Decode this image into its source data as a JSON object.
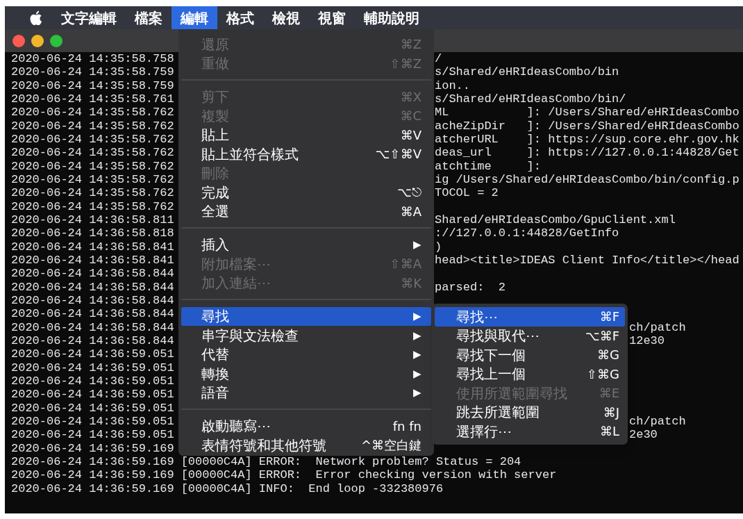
{
  "menu_bar": {
    "items": [
      {
        "label": "文字編輯",
        "selected": false
      },
      {
        "label": "檔案",
        "selected": false
      },
      {
        "label": "編輯",
        "selected": true
      },
      {
        "label": "格式",
        "selected": false
      },
      {
        "label": "檢視",
        "selected": false
      },
      {
        "label": "視窗",
        "selected": false
      },
      {
        "label": "輔助說明",
        "selected": false
      }
    ]
  },
  "terminal": {
    "lines": [
      {
        "timestamp": "2020-06-24 14:35:58.758",
        "message": "/",
        "kind": "menu_edge"
      },
      {
        "timestamp": "2020-06-24 14:35:58.759",
        "message": "s/Shared/eHRIdeasCombo/bin",
        "kind": "menu_edge"
      },
      {
        "timestamp": "2020-06-24 14:35:58.759",
        "message": "ion..",
        "kind": "menu_edge"
      },
      {
        "timestamp": "2020-06-24 14:35:58.761",
        "message": "s/Shared/eHRIdeasCombo/bin/",
        "kind": "menu_edge"
      },
      {
        "timestamp": "2020-06-24 14:35:58.762",
        "message": "ML           ]: /Users/Shared/eHRIdeasCombo",
        "kind": "menu_edge"
      },
      {
        "timestamp": "2020-06-24 14:35:58.762",
        "message": "acheZipDir   ]: /Users/Shared/eHRIdeasCombo",
        "kind": "menu_edge"
      },
      {
        "timestamp": "2020-06-24 14:35:58.762",
        "message": "atcherURL    ]: https://sup.core.ehr.gov.hk",
        "kind": "menu_edge"
      },
      {
        "timestamp": "2020-06-24 14:35:58.762",
        "message": "deas_url     ]: https://127.0.0.1:44828/Get",
        "kind": "menu_edge"
      },
      {
        "timestamp": "2020-06-24 14:35:58.762",
        "message": "atchtime     ]:",
        "kind": "menu_edge"
      },
      {
        "timestamp": "2020-06-24 14:35:58.762",
        "message": "ig /Users/Shared/eHRIdeasCombo/bin/config.p",
        "kind": "menu_edge"
      },
      {
        "timestamp": "2020-06-24 14:35:58.762",
        "message": "TOCOL = 2",
        "kind": "menu_edge"
      },
      {
        "timestamp": "2020-06-24 14:35:58.762"
      },
      {
        "timestamp": "2020-06-24 14:36:58.811",
        "message": "Shared/eHRIdeasCombo/GpuClient.xml",
        "kind": "menu_edge"
      },
      {
        "timestamp": "2020-06-24 14:36:58.818",
        "message": "://127.0.0.1:44828/GetInfo",
        "kind": "menu_edge"
      },
      {
        "timestamp": "2020-06-24 14:36:58.841",
        "message": ")",
        "kind": "menu_edge"
      },
      {
        "timestamp": "2020-06-24 14:36:58.841",
        "message": "head><title>IDEAS Client Info</title></head",
        "kind": "menu_edge"
      },
      {
        "timestamp": "2020-06-24 14:36:58.844"
      },
      {
        "timestamp": "2020-06-24 14:36:58.844",
        "message": "parsed:  2",
        "kind": "menu_edge"
      },
      {
        "timestamp": "2020-06-24 14:36:58.844"
      },
      {
        "timestamp": "2020-06-24 14:36:58.844"
      },
      {
        "timestamp": "2020-06-24 14:36:58.844",
        "message": "ch/patch",
        "kind": "submenu_edge"
      },
      {
        "timestamp": "2020-06-24 14:36:58.844",
        "message": "12e30",
        "kind": "submenu_edge"
      },
      {
        "timestamp": "2020-06-24 14:36:59.051"
      },
      {
        "timestamp": "2020-06-24 14:36:59.051"
      },
      {
        "timestamp": "2020-06-24 14:36:59.051"
      },
      {
        "timestamp": "2020-06-24 14:36:59.051"
      },
      {
        "timestamp": "2020-06-24 14:36:59.051"
      },
      {
        "timestamp": "2020-06-24 14:36:59.051",
        "message": "ch/patch",
        "kind": "submenu_edge"
      },
      {
        "timestamp": "2020-06-24 14:36:59.051",
        "message": "2e30",
        "kind": "submenu_edge"
      },
      {
        "timestamp": "2020-06-24 14:36:59.169"
      },
      {
        "timestamp": "2020-06-24 14:36:59.169",
        "message": "[00000C4A] ERROR:  Network problem? Status = 204",
        "kind": "inline"
      },
      {
        "timestamp": "2020-06-24 14:36:59.169",
        "message": "[00000C4A] ERROR:  Error checking version with server",
        "kind": "inline"
      },
      {
        "timestamp": "2020-06-24 14:36:59.169",
        "message": "[00000C4A] INFO:  End loop -332380976",
        "kind": "inline"
      }
    ]
  },
  "edit_menu": {
    "items": [
      {
        "kind": "item",
        "label": "還原",
        "shortcut": "⌘Z",
        "disabled": true,
        "selected": false
      },
      {
        "kind": "item",
        "label": "重做",
        "shortcut": "⇧⌘Z",
        "disabled": true,
        "selected": false
      },
      {
        "kind": "separator"
      },
      {
        "kind": "item",
        "label": "剪下",
        "shortcut": "⌘X",
        "disabled": true,
        "selected": false
      },
      {
        "kind": "item",
        "label": "複製",
        "shortcut": "⌘C",
        "disabled": true,
        "selected": false
      },
      {
        "kind": "item",
        "label": "貼上",
        "shortcut": "⌘V",
        "disabled": false,
        "selected": false
      },
      {
        "kind": "item",
        "label": "貼上並符合樣式",
        "shortcut": "⌥⇧⌘V",
        "disabled": false,
        "selected": false
      },
      {
        "kind": "item",
        "label": "刪除",
        "disabled": true,
        "selected": false
      },
      {
        "kind": "item",
        "label": "完成",
        "shortcut": "⌥⎋",
        "disabled": false,
        "selected": false
      },
      {
        "kind": "item",
        "label": "全選",
        "shortcut": "⌘A",
        "disabled": false,
        "selected": false
      },
      {
        "kind": "separator"
      },
      {
        "kind": "item",
        "label": "插入",
        "arrow": "▶",
        "disabled": false,
        "selected": false
      },
      {
        "kind": "item",
        "label": "附加檔案⋯",
        "shortcut": "⇧⌘A",
        "disabled": true,
        "selected": false
      },
      {
        "kind": "item",
        "label": "加入連結⋯",
        "shortcut": "⌘K",
        "disabled": true,
        "selected": false
      },
      {
        "kind": "separator"
      },
      {
        "kind": "item",
        "label": "尋找",
        "arrow": "▶",
        "disabled": false,
        "selected": true
      },
      {
        "kind": "item",
        "label": "串字與文法檢查",
        "arrow": "▶",
        "disabled": false,
        "selected": false
      },
      {
        "kind": "item",
        "label": "代替",
        "arrow": "▶",
        "disabled": false,
        "selected": false
      },
      {
        "kind": "item",
        "label": "轉換",
        "arrow": "▶",
        "disabled": false,
        "selected": false
      },
      {
        "kind": "item",
        "label": "語音",
        "arrow": "▶",
        "disabled": false,
        "selected": false
      },
      {
        "kind": "separator"
      },
      {
        "kind": "item",
        "label": "啟動聽寫⋯",
        "shortcut": "fn fn",
        "disabled": false,
        "selected": false
      },
      {
        "kind": "item",
        "label": "表情符號和其他符號",
        "shortcut": "^⌘空白鍵",
        "disabled": false,
        "selected": false
      }
    ]
  },
  "find_submenu": {
    "items": [
      {
        "label": "尋找⋯",
        "shortcut": "⌘F",
        "disabled": false,
        "selected": true
      },
      {
        "label": "尋找與取代⋯",
        "shortcut": "⌥⌘F",
        "disabled": false,
        "selected": false
      },
      {
        "label": "尋找下一個",
        "shortcut": "⌘G",
        "disabled": false,
        "selected": false
      },
      {
        "label": "尋找上一個",
        "shortcut": "⇧⌘G",
        "disabled": false,
        "selected": false
      },
      {
        "label": "使用所選範圍尋找",
        "shortcut": "⌘E",
        "disabled": true,
        "selected": false
      },
      {
        "label": "跳去所選範圍",
        "shortcut": "⌘J",
        "disabled": false,
        "selected": false
      },
      {
        "label": "選擇行⋯",
        "shortcut": "⌘L",
        "disabled": false,
        "selected": false
      }
    ]
  }
}
